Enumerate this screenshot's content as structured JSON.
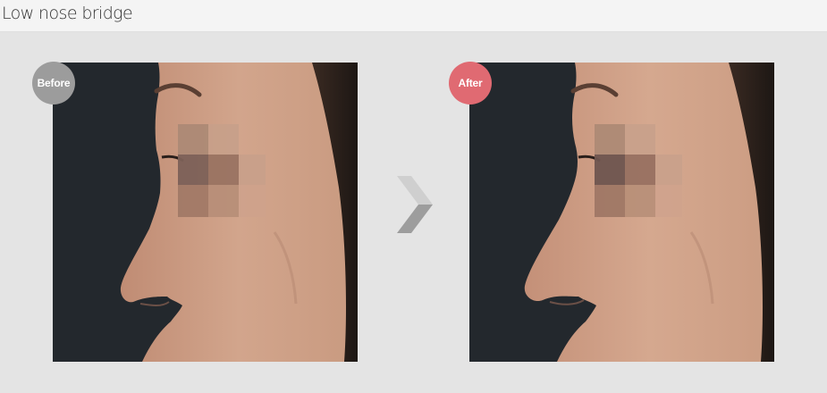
{
  "header": {
    "title": "Low nose bridge"
  },
  "before": {
    "badge": "Before"
  },
  "after": {
    "badge": "After"
  },
  "colors": {
    "before_badge": "#9c9c9c",
    "after_badge": "#e06a72",
    "photo_background": "#23282d",
    "skin": "#cfa28a",
    "arrow_light": "#cfcfcf",
    "arrow_dark": "#9d9d9d"
  },
  "icons": {
    "next": "chevron-right-icon"
  }
}
